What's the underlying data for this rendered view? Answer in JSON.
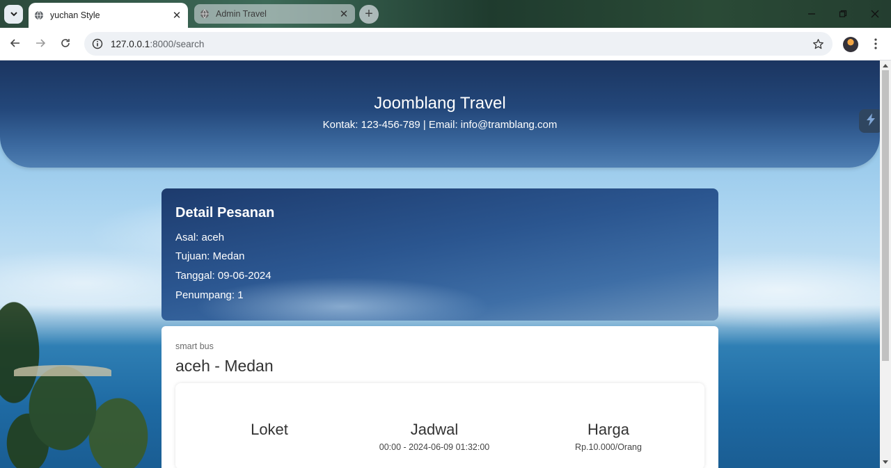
{
  "browser": {
    "tabs": [
      {
        "title": "yuchan Style",
        "active": true
      },
      {
        "title": "Admin Travel",
        "active": false
      }
    ],
    "close_glyph": "✕",
    "new_tab_glyph": "+",
    "url": {
      "host": "127.0.0.1",
      "path": ":8000/search"
    }
  },
  "header": {
    "title": "Joomblang Travel",
    "contact": "Kontak: 123-456-789 | Email: info@tramblang.com"
  },
  "detail": {
    "heading": "Detail Pesanan",
    "asal": "Asal: aceh",
    "tujuan": "Tujuan: Medan",
    "tanggal": "Tanggal: 09-06-2024",
    "penumpang": "Penumpang: 1"
  },
  "result": {
    "operator": "smart bus",
    "route": "aceh - Medan",
    "loket": {
      "label": "Loket"
    },
    "jadwal": {
      "label": "Jadwal",
      "value": "00:00 - 2024-06-09 01:32:00"
    },
    "harga": {
      "label": "Harga",
      "value": "Rp.10.000/Orang"
    }
  },
  "colors": {
    "header": "#23477a",
    "card": "#2b5690",
    "accent_text": "#ffffff"
  },
  "icons": {
    "tab_menu": "chevron-down-icon",
    "favicon": "globe-icon",
    "back": "arrow-left-icon",
    "forward": "arrow-right-icon",
    "reload": "reload-icon",
    "site_info": "info-icon",
    "bookmark": "star-icon",
    "menu": "kebab-icon",
    "side_widget": "lightning-icon"
  }
}
